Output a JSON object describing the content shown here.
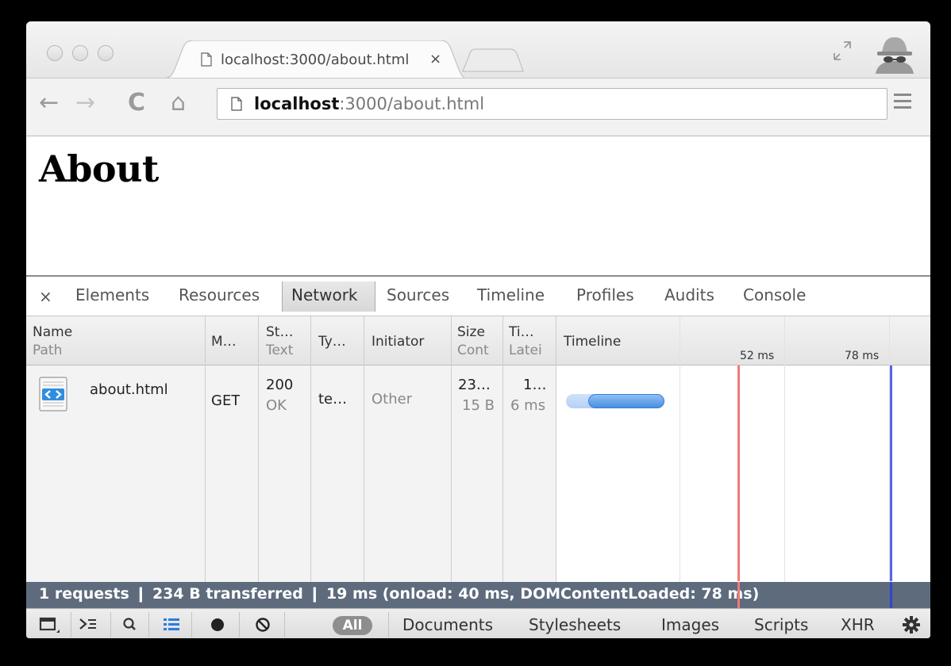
{
  "browser": {
    "tab_title": "localhost:3000/about.html",
    "tab_close": "×",
    "url_host": "localhost",
    "url_rest": ":3000/about.html",
    "back": "←",
    "forward": "→",
    "reload": "C",
    "home": "⌂",
    "star": "☆",
    "incognito": true
  },
  "page": {
    "heading": "About"
  },
  "devtools": {
    "close": "×",
    "tabs": [
      "Elements",
      "Resources",
      "Network",
      "Sources",
      "Timeline",
      "Profiles",
      "Audits",
      "Console"
    ],
    "active_tab": "Network",
    "columns": {
      "name": "Name",
      "path": "Path",
      "method": "M…",
      "status": "St…",
      "status_sub": "Text",
      "type": "Ty…",
      "initiator": "Initiator",
      "size": "Size",
      "size_sub": "Cont",
      "time": "Ti…",
      "time_sub": "Latei",
      "timeline": "Timeline"
    },
    "ticks": [
      "52 ms",
      "78 ms"
    ],
    "rows": [
      {
        "name": "about.html",
        "method": "GET",
        "status": "200",
        "status_text": "OK",
        "type": "te…",
        "initiator": "Other",
        "size": "23…",
        "content": "15 B",
        "time": "1…",
        "latency": "6 ms"
      }
    ],
    "status_bar": "1 requests  ❙  234 B transferred  ❙  19 ms (onload: 40 ms, DOMContentLoaded: 78 ms)",
    "bottom": {
      "all": "All",
      "filters": [
        "Documents",
        "Stylesheets",
        "Images",
        "Scripts",
        "XHR"
      ]
    }
  },
  "colors": {
    "status_bar": "#5e6b7d",
    "onload_line": "#f07a7a",
    "domcontent_line": "#5566ee",
    "timeline_bar": "#4a90e2"
  }
}
